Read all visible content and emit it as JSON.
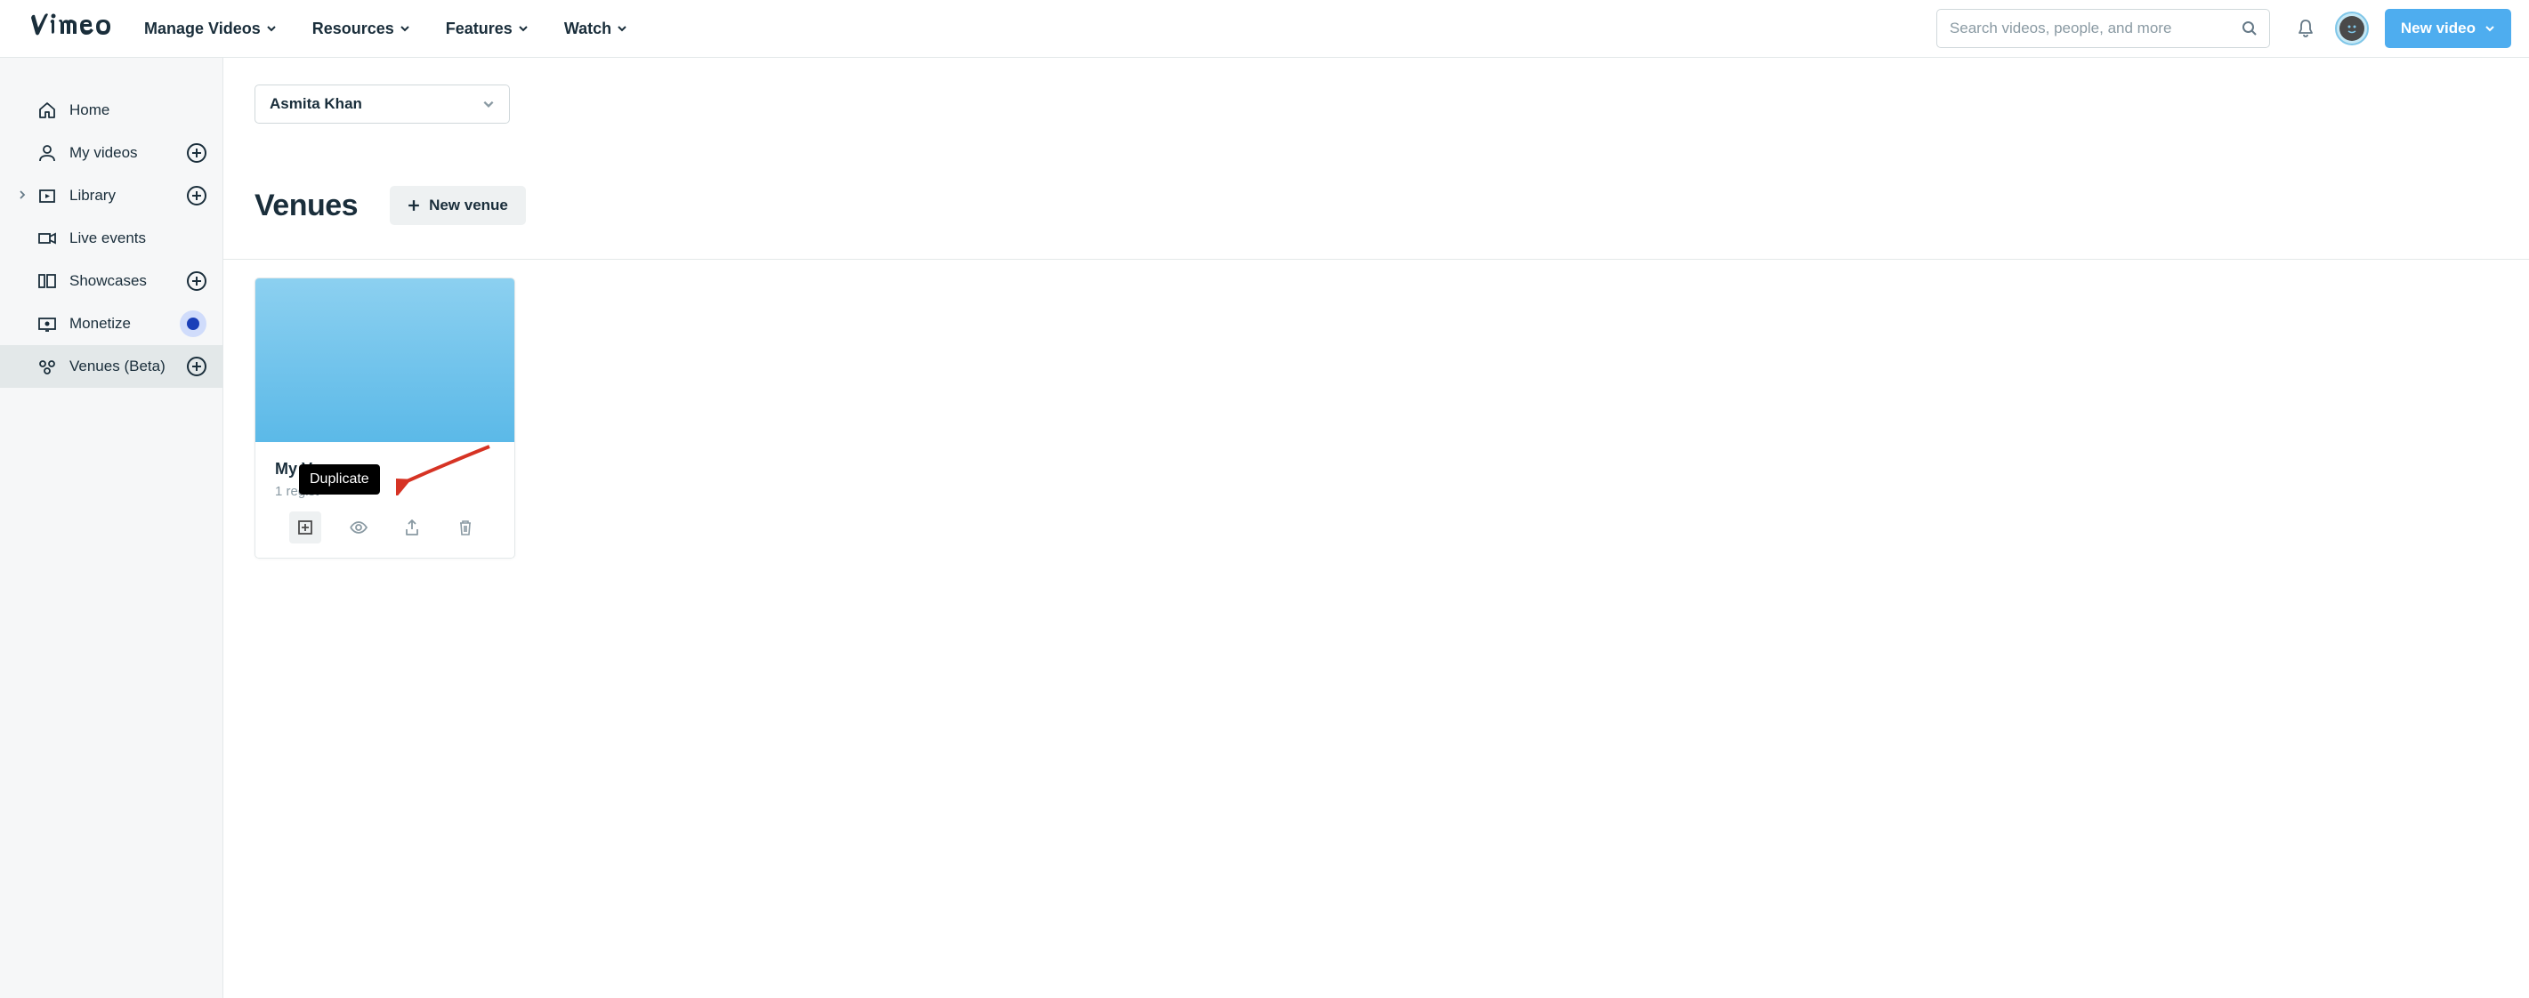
{
  "header": {
    "nav": {
      "manage": "Manage Videos",
      "resources": "Resources",
      "features": "Features",
      "watch": "Watch"
    },
    "search_placeholder": "Search videos, people, and more",
    "new_video": "New video"
  },
  "sidebar": {
    "home": "Home",
    "my_videos": "My videos",
    "library": "Library",
    "live_events": "Live events",
    "showcases": "Showcases",
    "monetize": "Monetize",
    "venues": "Venues (Beta)"
  },
  "main": {
    "account_name": "Asmita Khan",
    "heading": "Venues",
    "new_venue_btn": "New venue",
    "tooltip": "Duplicate",
    "card": {
      "title": "My Venue",
      "subtitle_visible": "1 regist"
    }
  }
}
